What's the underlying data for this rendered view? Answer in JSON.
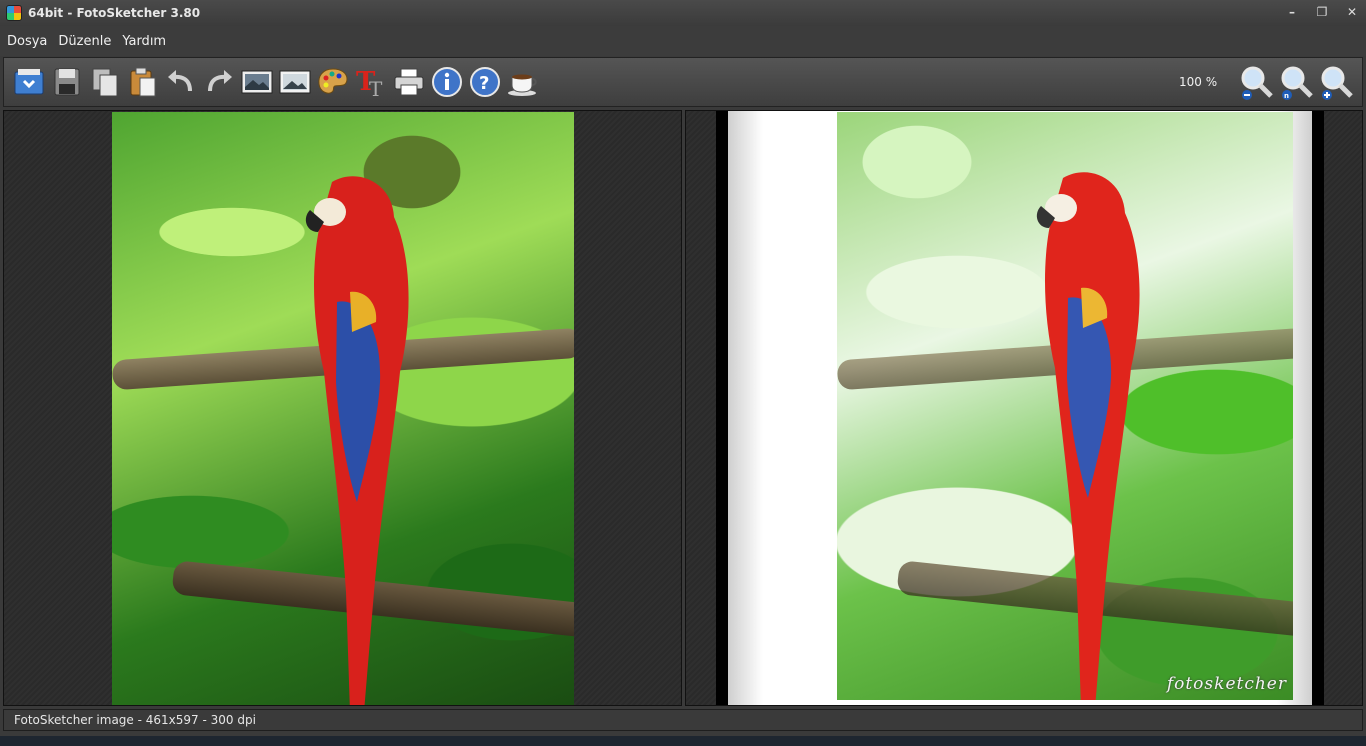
{
  "window": {
    "title": "64bit - FotoSketcher 3.80"
  },
  "menu": {
    "items": [
      "Dosya",
      "Düzenle",
      "Yardım"
    ]
  },
  "toolbar": {
    "buttons": [
      "open-image-icon",
      "save-icon",
      "copy-icon",
      "paste-icon",
      "undo-icon",
      "redo-icon",
      "original-image-icon",
      "sketch-image-icon",
      "painting-parameters-icon",
      "text-icon",
      "print-icon",
      "info-icon",
      "help-icon",
      "coffee-icon"
    ],
    "zoom_level": "100 %",
    "zoom_buttons": [
      "zoom-out-icon",
      "zoom-reset-icon",
      "zoom-in-icon"
    ]
  },
  "watermark": "fotosketcher",
  "status": {
    "text": "FotoSketcher image - 461x597 - 300 dpi"
  }
}
